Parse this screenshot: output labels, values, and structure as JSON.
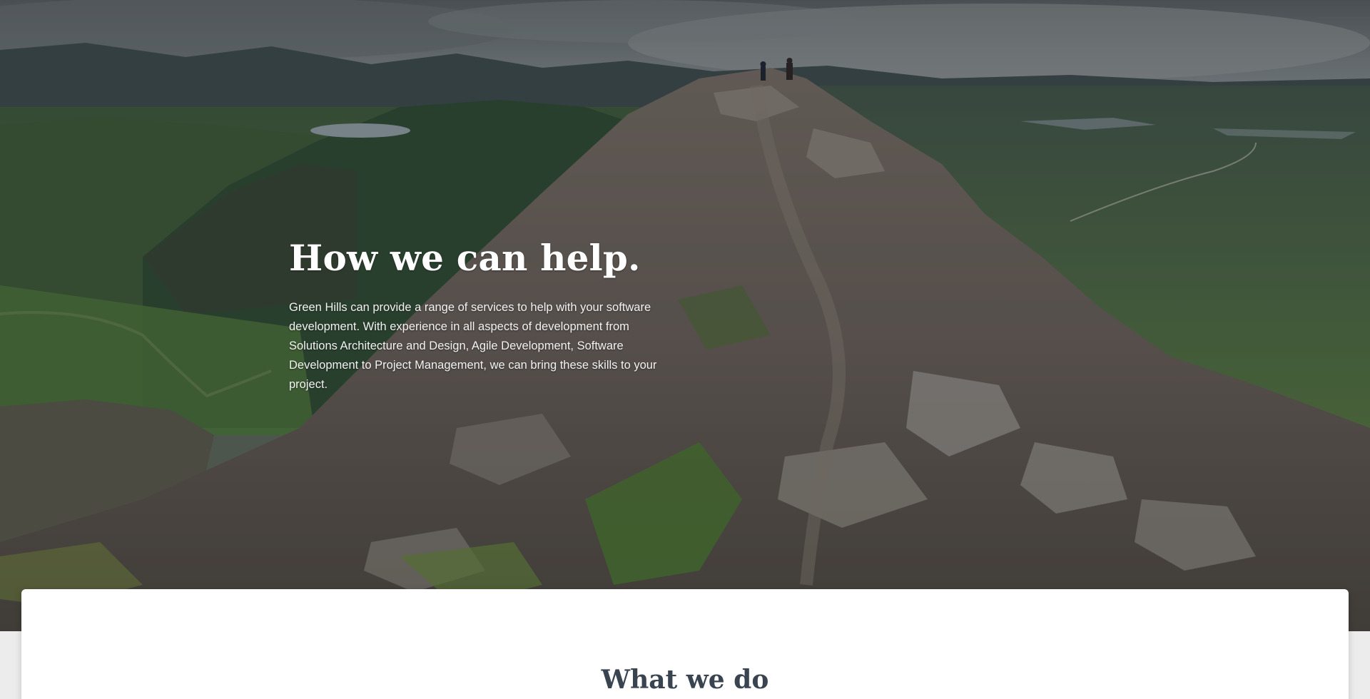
{
  "hero": {
    "title": "How we can help.",
    "description": "Green Hills can provide a range of services to help with your software development. With experience in all aspects of development from Solutions Architecture and Design, Agile Development, Software Development to Project Management, we can bring these skills to your project.",
    "background_image": "mountain-ridge-landscape"
  },
  "section": {
    "title": "What we do"
  },
  "colors": {
    "heading_dark": "#3a4350",
    "hero_text": "#ffffff",
    "card_bg": "#ffffff",
    "page_bg": "#ececec"
  }
}
